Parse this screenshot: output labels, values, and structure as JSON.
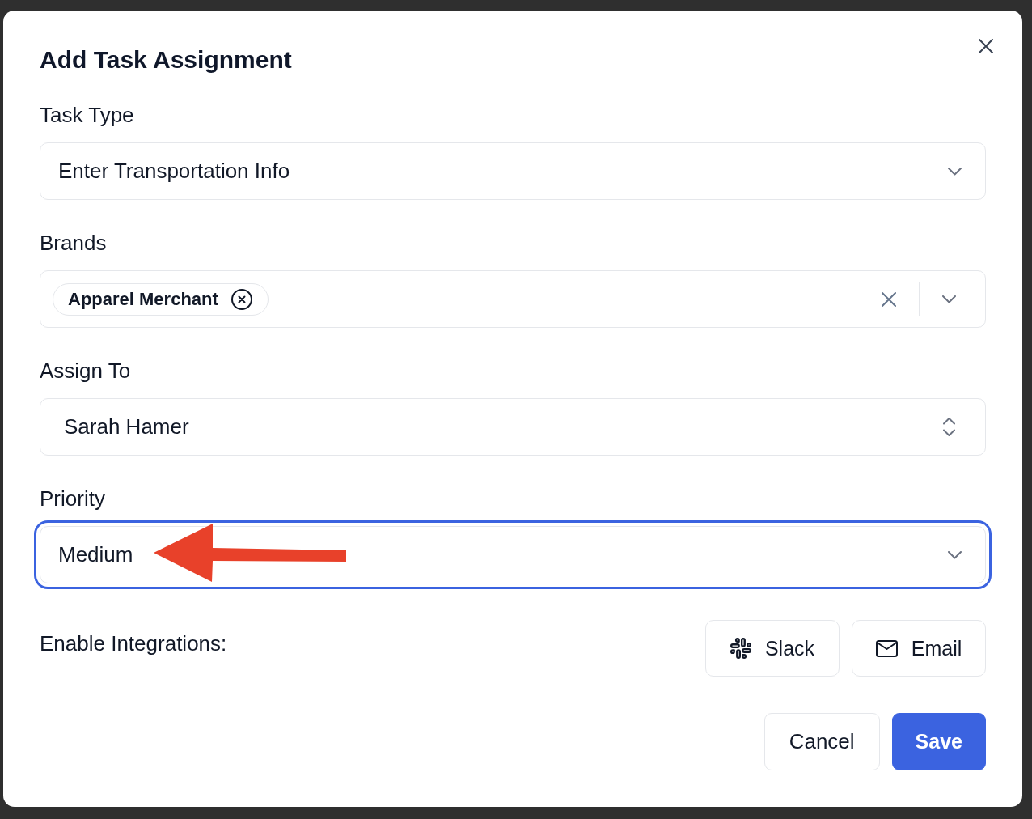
{
  "dialog": {
    "title": "Add Task Assignment"
  },
  "fields": [
    {
      "kind": "select",
      "label": "Task Type",
      "value": "Enter Transportation Info",
      "focused": false,
      "annotated": false
    },
    {
      "kind": "multi_select",
      "label": "Brands",
      "chips": [
        "Apparel Merchant"
      ],
      "focused": false,
      "annotated": false
    },
    {
      "kind": "listbox",
      "label": "Assign To",
      "value": "Sarah Hamer",
      "focused": false,
      "annotated": false
    },
    {
      "kind": "select",
      "label": "Priority",
      "value": "Medium",
      "focused": true,
      "annotated": true
    }
  ],
  "integrations": {
    "label": "Enable Integrations:",
    "options": [
      {
        "kind": "slack",
        "label": "Slack",
        "selected": false
      },
      {
        "kind": "email",
        "label": "Email",
        "selected": false
      }
    ]
  },
  "actions": [
    {
      "kind": "secondary",
      "label": "Cancel"
    },
    {
      "kind": "primary",
      "label": "Save"
    }
  ]
}
